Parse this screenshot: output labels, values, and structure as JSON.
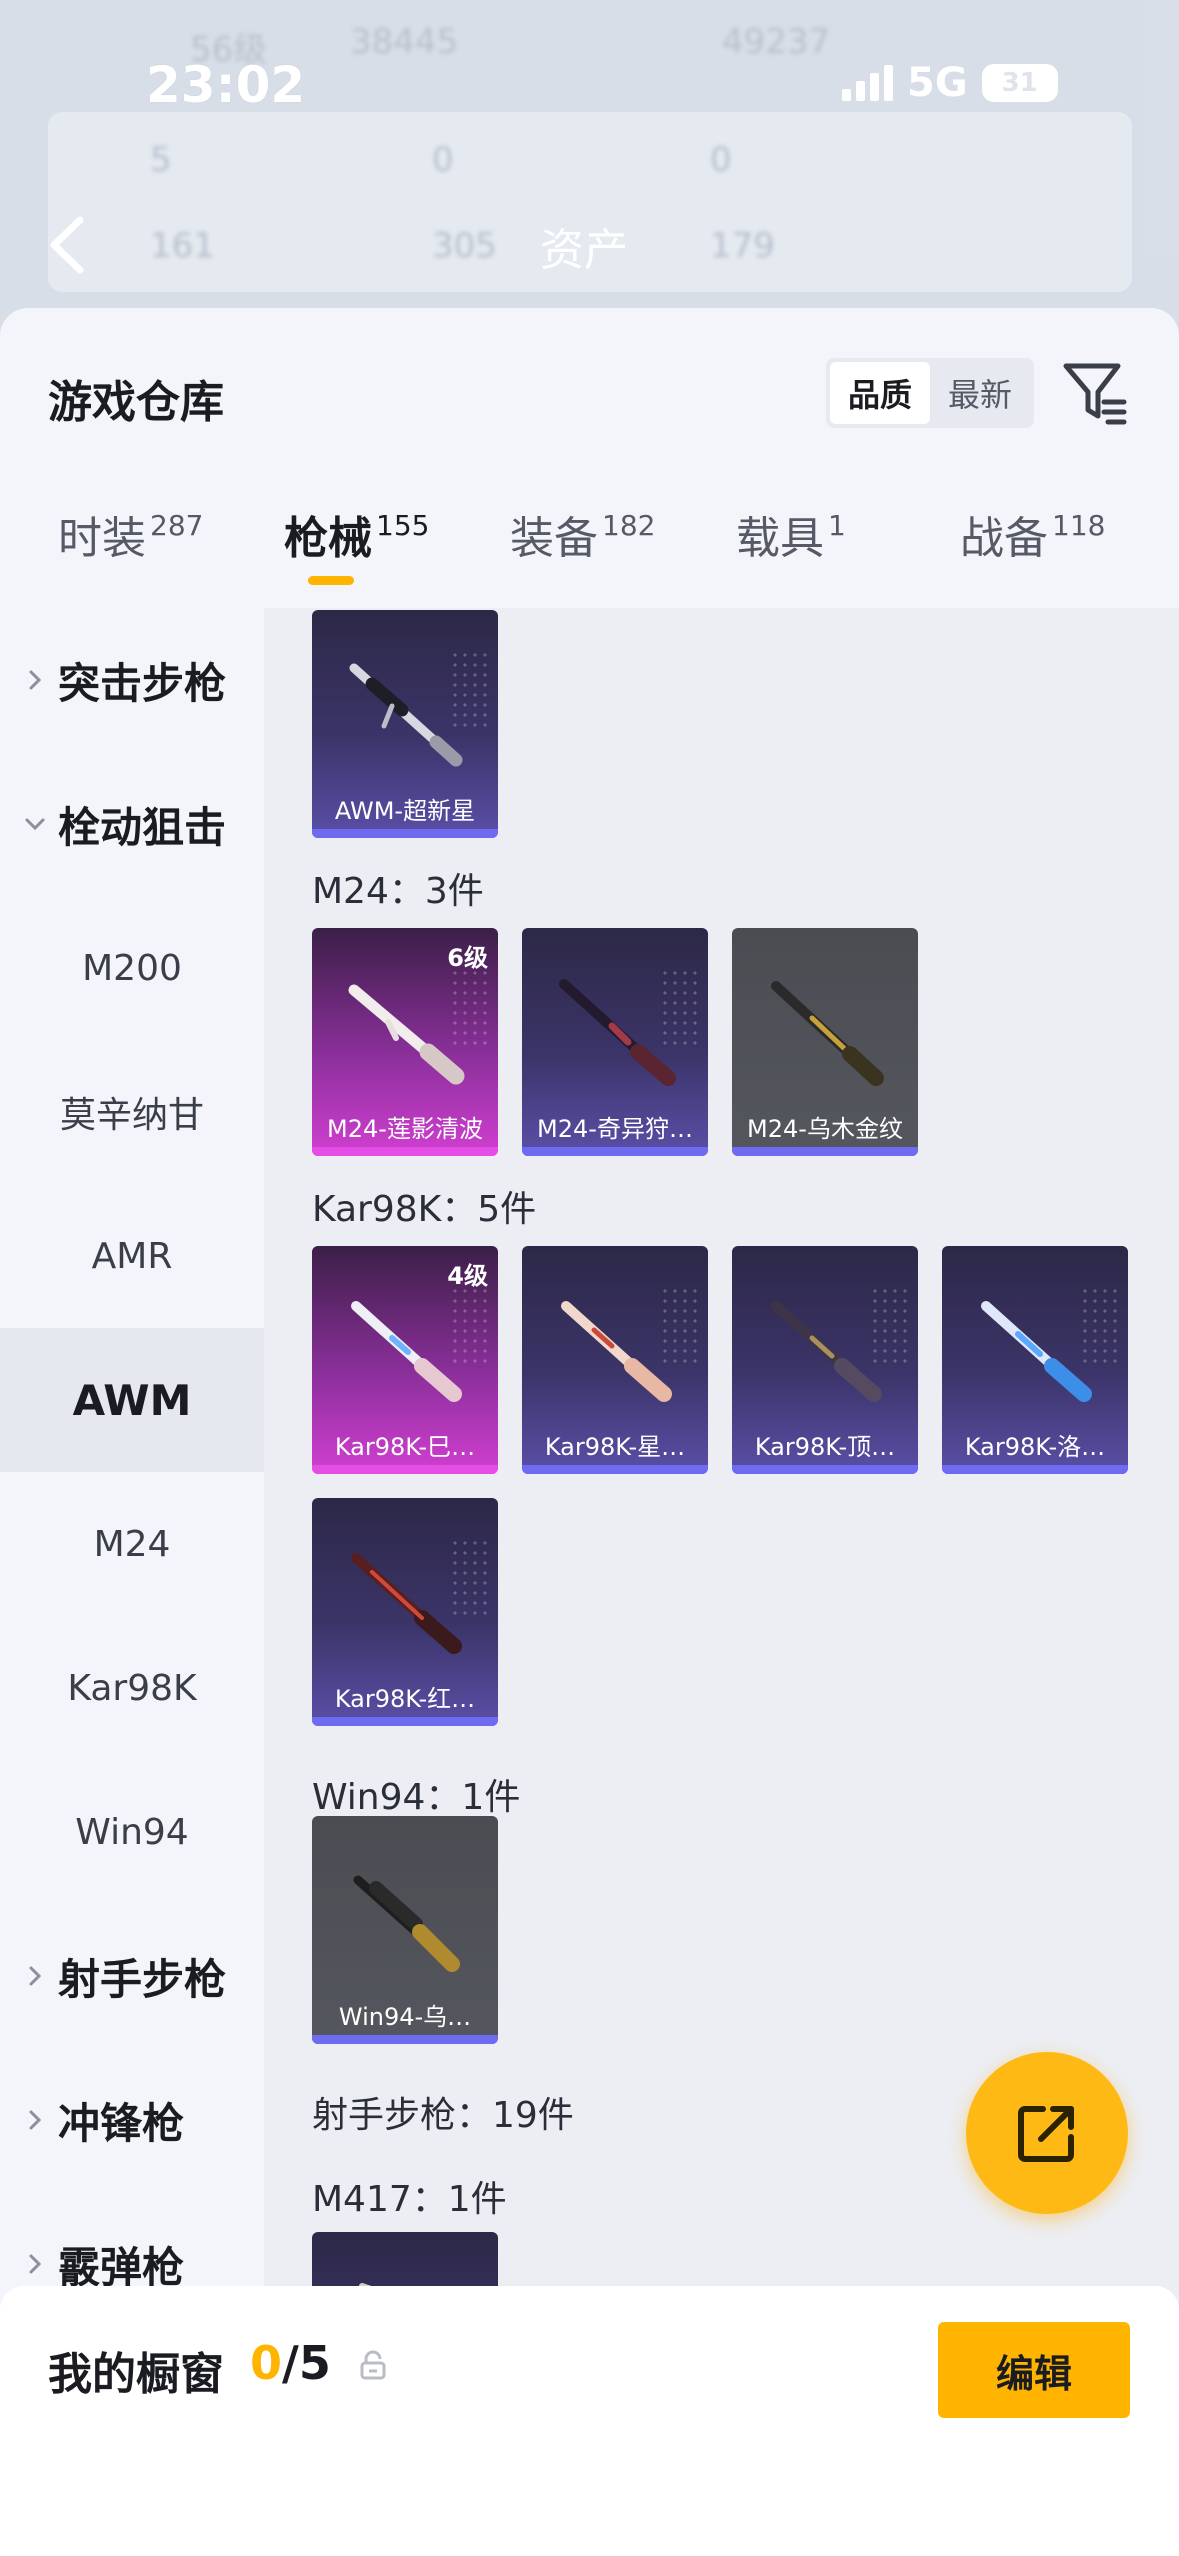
{
  "status": {
    "time": "23:02",
    "network": "5G",
    "battery": "31"
  },
  "nav": {
    "title": "资产"
  },
  "background_faded": {
    "level": "56级",
    "coins": "38445",
    "points": "49237",
    "stat1": "5",
    "stat2": "0",
    "stat3": "0",
    "stat4": "161",
    "stat5": "305",
    "stat6": "179"
  },
  "sheet": {
    "title": "游戏仓库",
    "sort": {
      "quality": "品质",
      "latest": "最新",
      "selected": "品质"
    }
  },
  "tabs": [
    {
      "label": "时装",
      "count": "287"
    },
    {
      "label": "枪械",
      "count": "155",
      "active": true
    },
    {
      "label": "装备",
      "count": "182"
    },
    {
      "label": "载具",
      "count": "1"
    },
    {
      "label": "战备",
      "count": "118"
    }
  ],
  "sidebar": {
    "items": [
      {
        "label": "突击步枪",
        "type": "group",
        "expanded": false
      },
      {
        "label": "栓动狙击",
        "type": "group",
        "expanded": true
      },
      {
        "label": "M200",
        "type": "sub"
      },
      {
        "label": "莫辛纳甘",
        "type": "sub"
      },
      {
        "label": "AMR",
        "type": "sub"
      },
      {
        "label": "AWM",
        "type": "sub",
        "selected": true
      },
      {
        "label": "M24",
        "type": "sub"
      },
      {
        "label": "Kar98K",
        "type": "sub"
      },
      {
        "label": "Win94",
        "type": "sub"
      },
      {
        "label": "射手步枪",
        "type": "group",
        "expanded": false
      },
      {
        "label": "冲锋枪",
        "type": "group",
        "expanded": false
      },
      {
        "label": "霰弹枪",
        "type": "group",
        "expanded": false
      }
    ]
  },
  "content": {
    "awm_items": [
      {
        "name": "AWM-超新星",
        "rarity": "purple"
      }
    ],
    "m24_title": "M24：3件",
    "m24_items": [
      {
        "name": "M24-莲影清波",
        "rarity": "pink",
        "level": "6级"
      },
      {
        "name": "M24-奇异狩…",
        "rarity": "purple"
      },
      {
        "name": "M24-乌木金纹",
        "rarity": "gray"
      }
    ],
    "kar_title": "Kar98K：5件",
    "kar_items": [
      {
        "name": "Kar98K-巳…",
        "rarity": "pink",
        "level": "4级"
      },
      {
        "name": "Kar98K-星…",
        "rarity": "purple"
      },
      {
        "name": "Kar98K-顶…",
        "rarity": "purple"
      },
      {
        "name": "Kar98K-洛…",
        "rarity": "purple"
      },
      {
        "name": "Kar98K-红…",
        "rarity": "purple"
      }
    ],
    "win_title": "Win94：1件",
    "win_items": [
      {
        "name": "Win94-乌…",
        "rarity": "gray"
      }
    ],
    "dmr_title": "射手步枪：19件",
    "m417_title": "M417：1件"
  },
  "bottom": {
    "showcase_label": "我的橱窗",
    "showcase_current": "0",
    "showcase_total": "/5",
    "edit_label": "编辑"
  },
  "colors": {
    "accent": "#ffb400",
    "purple_rarity": "#6e6bf0",
    "pink_rarity": "#e44ee6"
  }
}
